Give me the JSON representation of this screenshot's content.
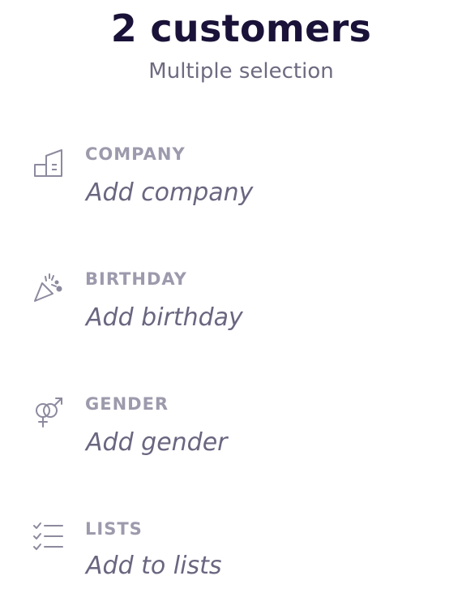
{
  "header": {
    "title": "2 customers",
    "subtitle": "Multiple selection"
  },
  "fields": [
    {
      "icon": "company-building-icon",
      "label": "COMPANY",
      "placeholder": "Add company"
    },
    {
      "icon": "party-popper-icon",
      "label": "BIRTHDAY",
      "placeholder": "Add birthday"
    },
    {
      "icon": "gender-icon",
      "label": "GENDER",
      "placeholder": "Add gender"
    },
    {
      "icon": "checklist-icon",
      "label": "LISTS",
      "placeholder": "Add to lists"
    }
  ],
  "colors": {
    "title": "#1a1238",
    "subtitle": "#6e6a80",
    "label": "#9c9aac",
    "value": "#6a6680",
    "icon": "#8c8a9e"
  }
}
